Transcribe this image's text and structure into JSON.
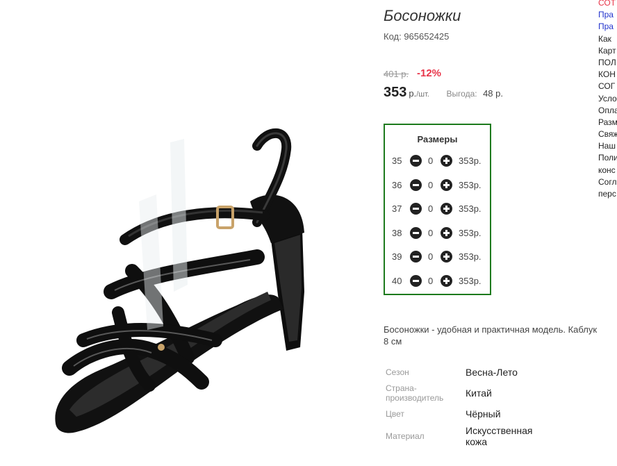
{
  "product": {
    "title": "Босоножки",
    "code": "Код: 965652425",
    "old_price": "401 р.",
    "discount": "-12%",
    "price": "353",
    "price_unit": "р.",
    "price_per": "/шт.",
    "benefit_label": "Выгода:",
    "benefit_value": "48 р."
  },
  "sizes": {
    "title": "Размеры",
    "rows": [
      {
        "size": "35",
        "qty": "0",
        "price": "353р."
      },
      {
        "size": "36",
        "qty": "0",
        "price": "353р."
      },
      {
        "size": "37",
        "qty": "0",
        "price": "353р."
      },
      {
        "size": "38",
        "qty": "0",
        "price": "353р."
      },
      {
        "size": "39",
        "qty": "0",
        "price": "353р."
      },
      {
        "size": "40",
        "qty": "0",
        "price": "353р."
      }
    ]
  },
  "description": {
    "line1": "Босоножки - удобная и практичная модель. Каблук",
    "line2": "8 см"
  },
  "attributes": [
    {
      "label": "Сезон",
      "value": "Весна-Лето"
    },
    {
      "label": "Страна-производитель",
      "label_l1": "Страна-",
      "label_l2": "производитель",
      "value": "Китай"
    },
    {
      "label": "Цвет",
      "value": "Чёрный"
    },
    {
      "label": "Материал",
      "value_l1": "Искусственная",
      "value_l2": "кожа"
    }
  ],
  "side_links": [
    "СОТ",
    "Пра",
    "Пра",
    "Как",
    "Карт",
    "ПОЛ",
    "КОН",
    "СОГ",
    "Усло",
    "Опла",
    "Разм",
    "Свяж",
    "Наш",
    "Поли",
    "конс",
    "Согл",
    "перс"
  ],
  "colors": {
    "accent_red": "#e8354a",
    "sizes_border": "#1d7a1d",
    "link_blue": "#2233cc"
  },
  "icons": {
    "minus": "minus-circle-icon",
    "plus": "plus-circle-icon"
  }
}
